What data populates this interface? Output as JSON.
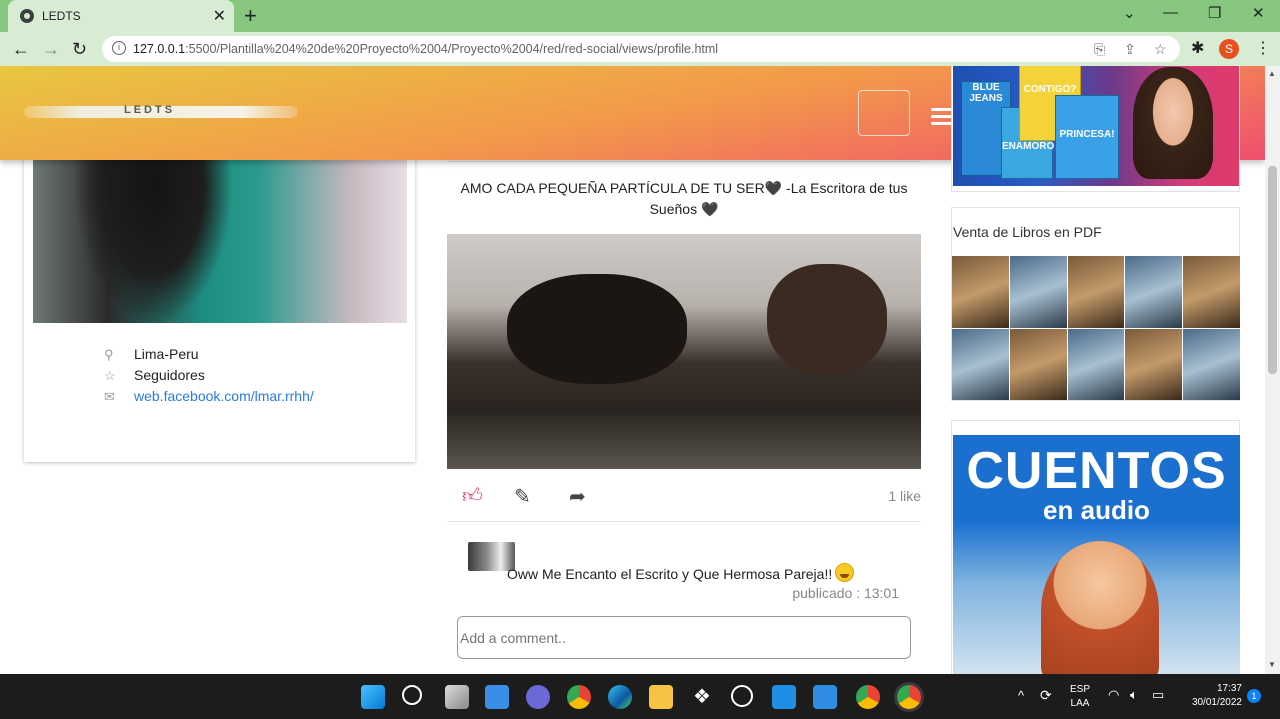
{
  "browser": {
    "tab_title": "LEDTS",
    "tab_close": "✕",
    "new_tab": "+",
    "url_host": "127.0.0.1",
    "url_rest": ":5500/Plantilla%204%20de%20Proyecto%2004/Proyecto%2004/red/red-social/views/profile.html",
    "profile_initial": "S",
    "back": "←",
    "forward": "→",
    "reload": "↻",
    "win_minimize": "⌄",
    "win_restore": "—",
    "win_max": "❐",
    "win_close": "✕"
  },
  "site": {
    "logo_text": "LEDTS"
  },
  "profile": {
    "location": "Lima-Peru",
    "followers_label": "Seguidores",
    "link": "web.facebook.com/lmar.rrhh/"
  },
  "post": {
    "text": "AMO CADA PEQUEÑA PARTÍCULA DE TU SER🖤 -La Escritora de tus Sueños 🖤",
    "likes": "1 like",
    "comment_text": "Oww Me Encanto el Escrito y Que Hermosa Pareja!!",
    "comment_meta": "publicado : 13:01",
    "comment_placeholder": "Add a comment.."
  },
  "ads": {
    "ad1_book1": "BLUE JEANS",
    "ad1_book2": "CONTIGO?",
    "ad1_book3": "ENAMORO",
    "ad1_book4": "PRINCESA!",
    "ad2_label": "Venta de Libros en PDF",
    "ad3_title": "CUENTOS",
    "ad3_subtitle": "en audio"
  },
  "taskbar": {
    "lang_top": "ESP",
    "lang_bottom": "LAA",
    "time": "17:37",
    "date": "30/01/2022",
    "notif_count": "1"
  },
  "colors": {
    "header_start": "#e8c740",
    "header_end": "#f0506e",
    "like_accent": "#e8375a",
    "link": "#2a7ae2"
  }
}
